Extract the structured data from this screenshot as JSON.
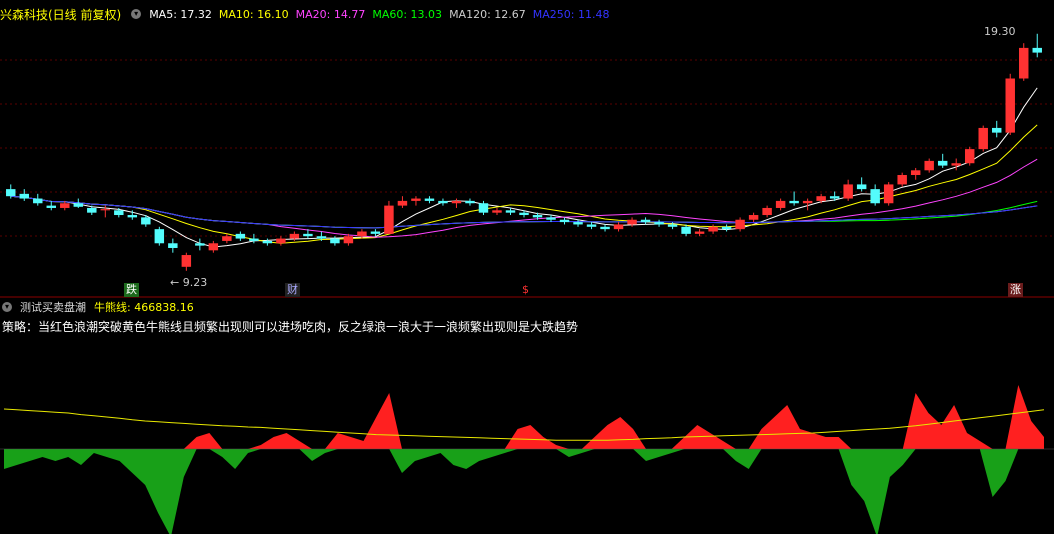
{
  "header": {
    "stock_name": "兴森科技(日线 前复权)",
    "ma": [
      {
        "label": "MA5: 17.32",
        "color": "#ffffff"
      },
      {
        "label": "MA10: 16.10",
        "color": "#ffff00"
      },
      {
        "label": "MA20: 14.77",
        "color": "#ff44ff"
      },
      {
        "label": "MA60: 13.03",
        "color": "#00ff00"
      },
      {
        "label": "MA120: 12.67",
        "color": "#cccccc"
      },
      {
        "label": "MA250: 11.48",
        "color": "#3333ff"
      }
    ]
  },
  "indicator": {
    "title": "测试买卖盘潮",
    "line_label": "牛熊线: 466838.16",
    "strategy": "策略：当红色浪潮突破黄色牛熊线且频繁出现则可以进场吃肉，反之绿浪一浪大于一浪频繁出现则是大跌趋势"
  },
  "annotations": {
    "high": "19.30",
    "low": "9.23",
    "tag_die": "跌",
    "tag_cai": "财",
    "tag_s": "$",
    "tag_zhang": "涨"
  },
  "colors": {
    "up": "#ff3232",
    "down": "#54fcfc",
    "bull": "#ff2020",
    "bear": "#18a018",
    "yellow": "#e8e800"
  },
  "chart_data": {
    "type": "candlestick",
    "price_ylim": [
      8.5,
      19.8
    ],
    "candles": [
      [
        12.7,
        12.9,
        12.3,
        12.4
      ],
      [
        12.5,
        12.7,
        12.2,
        12.3
      ],
      [
        12.3,
        12.5,
        12.0,
        12.1
      ],
      [
        12.0,
        12.2,
        11.8,
        11.9
      ],
      [
        11.9,
        12.2,
        11.8,
        12.1
      ],
      [
        12.1,
        12.3,
        11.9,
        11.95
      ],
      [
        11.9,
        12.0,
        11.6,
        11.7
      ],
      [
        11.8,
        12.0,
        11.5,
        11.85
      ],
      [
        11.8,
        11.9,
        11.5,
        11.6
      ],
      [
        11.6,
        11.8,
        11.4,
        11.5
      ],
      [
        11.5,
        11.6,
        11.1,
        11.2
      ],
      [
        11.0,
        11.1,
        10.3,
        10.4
      ],
      [
        10.4,
        10.6,
        10.0,
        10.2
      ],
      [
        9.4,
        10.0,
        9.23,
        9.9
      ],
      [
        10.4,
        10.6,
        10.1,
        10.3
      ],
      [
        10.1,
        10.5,
        10.0,
        10.4
      ],
      [
        10.5,
        10.8,
        10.4,
        10.7
      ],
      [
        10.8,
        10.9,
        10.5,
        10.6
      ],
      [
        10.6,
        10.8,
        10.4,
        10.5
      ],
      [
        10.5,
        10.6,
        10.3,
        10.4
      ],
      [
        10.4,
        10.7,
        10.3,
        10.6
      ],
      [
        10.6,
        10.9,
        10.5,
        10.8
      ],
      [
        10.8,
        11.0,
        10.6,
        10.7
      ],
      [
        10.7,
        10.9,
        10.5,
        10.6
      ],
      [
        10.6,
        10.7,
        10.3,
        10.4
      ],
      [
        10.4,
        10.8,
        10.3,
        10.7
      ],
      [
        10.7,
        11.0,
        10.6,
        10.9
      ],
      [
        10.9,
        11.0,
        10.7,
        10.8
      ],
      [
        10.8,
        12.2,
        10.8,
        12.0
      ],
      [
        12.0,
        12.4,
        11.9,
        12.2
      ],
      [
        12.2,
        12.4,
        12.0,
        12.3
      ],
      [
        12.3,
        12.4,
        12.1,
        12.2
      ],
      [
        12.2,
        12.3,
        12.0,
        12.1
      ],
      [
        12.1,
        12.3,
        11.9,
        12.2
      ],
      [
        12.2,
        12.3,
        12.0,
        12.1
      ],
      [
        12.1,
        12.2,
        11.6,
        11.7
      ],
      [
        11.7,
        11.9,
        11.6,
        11.8
      ],
      [
        11.8,
        11.9,
        11.6,
        11.7
      ],
      [
        11.7,
        11.8,
        11.5,
        11.6
      ],
      [
        11.6,
        11.7,
        11.4,
        11.5
      ],
      [
        11.5,
        11.6,
        11.3,
        11.4
      ],
      [
        11.4,
        11.5,
        11.2,
        11.3
      ],
      [
        11.3,
        11.4,
        11.1,
        11.2
      ],
      [
        11.2,
        11.3,
        11.0,
        11.1
      ],
      [
        11.1,
        11.2,
        10.9,
        11.0
      ],
      [
        11.0,
        11.3,
        10.9,
        11.2
      ],
      [
        11.2,
        11.5,
        11.1,
        11.4
      ],
      [
        11.4,
        11.5,
        11.2,
        11.3
      ],
      [
        11.3,
        11.4,
        11.1,
        11.2
      ],
      [
        11.2,
        11.3,
        11.0,
        11.1
      ],
      [
        11.1,
        11.2,
        10.7,
        10.8
      ],
      [
        10.8,
        11.0,
        10.7,
        10.9
      ],
      [
        10.9,
        11.2,
        10.8,
        11.1
      ],
      [
        11.1,
        11.2,
        10.9,
        11.0
      ],
      [
        11.0,
        11.5,
        10.9,
        11.4
      ],
      [
        11.4,
        11.7,
        11.3,
        11.6
      ],
      [
        11.6,
        12.0,
        11.5,
        11.9
      ],
      [
        11.9,
        12.3,
        11.8,
        12.2
      ],
      [
        12.2,
        12.6,
        12.0,
        12.1
      ],
      [
        12.1,
        12.3,
        11.8,
        12.2
      ],
      [
        12.2,
        12.5,
        12.1,
        12.4
      ],
      [
        12.4,
        12.6,
        12.2,
        12.3
      ],
      [
        12.3,
        13.1,
        12.2,
        12.9
      ],
      [
        12.9,
        13.2,
        12.6,
        12.7
      ],
      [
        12.7,
        12.9,
        12.0,
        12.1
      ],
      [
        12.1,
        13.0,
        12.0,
        12.9
      ],
      [
        12.9,
        13.4,
        12.8,
        13.3
      ],
      [
        13.3,
        13.6,
        13.1,
        13.5
      ],
      [
        13.5,
        14.0,
        13.4,
        13.9
      ],
      [
        13.9,
        14.2,
        13.6,
        13.7
      ],
      [
        13.7,
        14.0,
        13.5,
        13.8
      ],
      [
        13.8,
        14.5,
        13.7,
        14.4
      ],
      [
        14.4,
        15.4,
        14.3,
        15.3
      ],
      [
        15.3,
        15.6,
        14.9,
        15.1
      ],
      [
        15.1,
        17.6,
        15.0,
        17.4
      ],
      [
        17.4,
        18.9,
        17.3,
        18.7
      ],
      [
        18.7,
        19.3,
        18.3,
        18.5
      ]
    ],
    "wave": [
      -5,
      -4,
      -3,
      -2,
      -3,
      -2,
      -4,
      -1,
      -2,
      -3,
      -6,
      -9,
      -16,
      -22,
      -7,
      3,
      4,
      -2,
      -5,
      -1,
      1,
      3,
      4,
      2,
      -3,
      -1,
      4,
      3,
      2,
      8,
      14,
      -6,
      -3,
      -2,
      -1,
      -4,
      -5,
      -3,
      -2,
      -1,
      5,
      6,
      3,
      1,
      -2,
      -1,
      3,
      6,
      8,
      5,
      -3,
      -2,
      -1,
      3,
      6,
      4,
      2,
      -3,
      -5,
      5,
      8,
      11,
      5,
      4,
      3,
      3,
      -9,
      -13,
      -22,
      -7,
      -4,
      14,
      9,
      6,
      11,
      4,
      2,
      -12,
      -8,
      16,
      7,
      3
    ],
    "bull_bear_line": [
      10,
      9.8,
      9.6,
      9.4,
      9.2,
      9,
      8.6,
      8.3,
      8,
      7.7,
      7.3,
      7,
      6.8,
      6.6,
      6.4,
      6.2,
      6,
      5.8,
      5.7,
      5.5,
      5.4,
      5.2,
      5,
      4.8,
      4.6,
      4.4,
      4.2,
      4,
      3.8,
      3.6,
      3.5,
      3.4,
      3.3,
      3.2,
      3.1,
      3,
      2.9,
      2.8,
      2.7,
      2.6,
      2.5,
      2.4,
      2.3,
      2.2,
      2.2,
      2.2,
      2.2,
      2.2,
      2.3,
      2.4,
      2.6,
      2.7,
      2.8,
      3,
      3.1,
      3.2,
      3.3,
      3.4,
      3.5,
      3.6,
      3.7,
      3.8,
      3.9,
      4,
      4.2,
      4.4,
      4.6,
      4.8,
      5,
      5.2,
      5.5,
      5.8,
      6.2,
      6.6,
      7,
      7.4,
      7.8,
      8.2,
      8.6,
      9,
      9.4,
      9.8
    ]
  }
}
